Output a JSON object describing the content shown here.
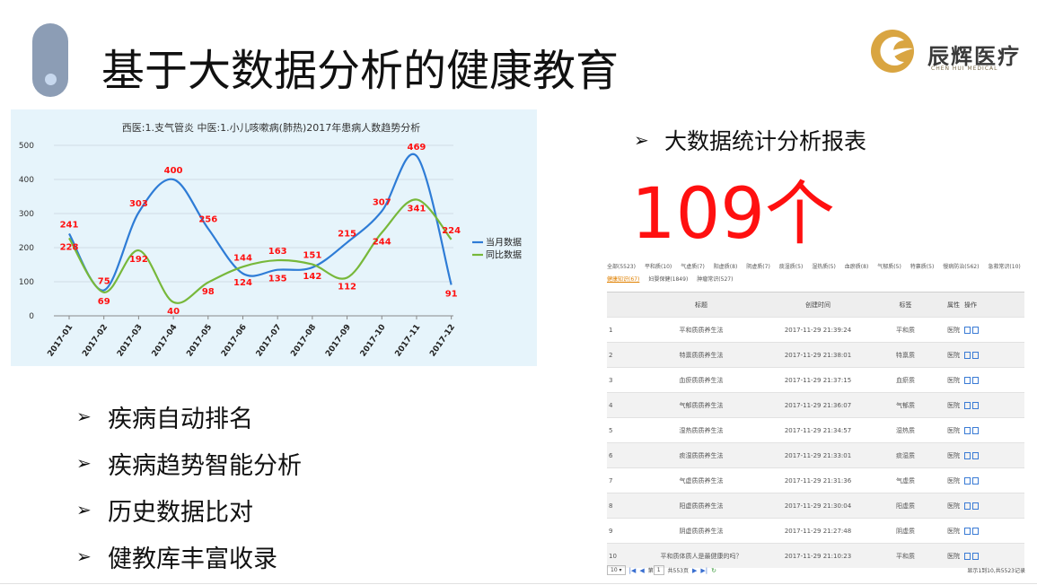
{
  "slide": {
    "title": "基于大数据分析的健康教育",
    "logo_text": "辰辉医疗",
    "logo_sub": "CHEN HUI MEDICAL",
    "bullets": [
      "疾病自动排名",
      "疾病趋势智能分析",
      "历史数据比对",
      "健教库丰富收录"
    ],
    "right_heading": "大数据统计分析报表",
    "big_count": "109个",
    "arrow": "➢"
  },
  "colors": {
    "series_current": "#2e7cd6",
    "series_yoy": "#77b83a",
    "label_red": "#ff1010",
    "panel_bg": "#e6f4fb"
  },
  "chart_data": {
    "type": "line",
    "title": "西医:1.支气管炎 中医:1.小儿咳嗽病(肺热)2017年患病人数趋势分析",
    "categories": [
      "2017-01",
      "2017-02",
      "2017-03",
      "2017-04",
      "2017-05",
      "2017-06",
      "2017-07",
      "2017-08",
      "2017-09",
      "2017-10",
      "2017-11",
      "2017-12"
    ],
    "series": [
      {
        "name": "当月数据",
        "values": [
          241,
          75,
          303,
          400,
          256,
          124,
          135,
          142,
          215,
          307,
          469,
          91
        ]
      },
      {
        "name": "同比数据",
        "values": [
          228,
          69,
          192,
          40,
          98,
          144,
          163,
          151,
          112,
          244,
          341,
          224
        ]
      }
    ],
    "ylim": [
      0,
      500
    ],
    "yticks": [
      0,
      100,
      200,
      300,
      400,
      500
    ],
    "grid": true,
    "legend": "right"
  },
  "report": {
    "filters": [
      {
        "label": "全部(5523)",
        "active": false
      },
      {
        "label": "平和质(10)",
        "active": false
      },
      {
        "label": "气虚质(7)",
        "active": false
      },
      {
        "label": "阳虚质(8)",
        "active": false
      },
      {
        "label": "阴虚质(7)",
        "active": false
      },
      {
        "label": "痰湿质(5)",
        "active": false
      },
      {
        "label": "湿热质(5)",
        "active": false
      },
      {
        "label": "血瘀质(8)",
        "active": false
      },
      {
        "label": "气郁质(5)",
        "active": false
      },
      {
        "label": "特禀质(5)",
        "active": false
      },
      {
        "label": "慢病防治(562)",
        "active": false
      },
      {
        "label": "急救常识(10)",
        "active": false
      },
      {
        "label": "健康知识(67)",
        "active": true
      },
      {
        "label": "妇婴保健(1849)",
        "active": false
      },
      {
        "label": "肿瘤常识(527)",
        "active": false
      }
    ],
    "columns": [
      "",
      "标题",
      "创建时间",
      "标签",
      "属性",
      "操作"
    ],
    "rows": [
      {
        "idx": "1",
        "title": "平和质质养生法",
        "time": "2017-11-29 21:39:24",
        "tag": "平和质",
        "attr": "医院"
      },
      {
        "idx": "2",
        "title": "特禀质质养生法",
        "time": "2017-11-29 21:38:01",
        "tag": "特禀质",
        "attr": "医院"
      },
      {
        "idx": "3",
        "title": "血瘀质质养生法",
        "time": "2017-11-29 21:37:15",
        "tag": "血瘀质",
        "attr": "医院"
      },
      {
        "idx": "4",
        "title": "气郁质质养生法",
        "time": "2017-11-29 21:36:07",
        "tag": "气郁质",
        "attr": "医院"
      },
      {
        "idx": "5",
        "title": "湿热质质养生法",
        "time": "2017-11-29 21:34:57",
        "tag": "湿热质",
        "attr": "医院"
      },
      {
        "idx": "6",
        "title": "痰湿质质养生法",
        "time": "2017-11-29 21:33:01",
        "tag": "痰湿质",
        "attr": "医院"
      },
      {
        "idx": "7",
        "title": "气虚质质养生法",
        "time": "2017-11-29 21:31:36",
        "tag": "气虚质",
        "attr": "医院"
      },
      {
        "idx": "8",
        "title": "阳虚质质养生法",
        "time": "2017-11-29 21:30:04",
        "tag": "阳虚质",
        "attr": "医院"
      },
      {
        "idx": "9",
        "title": "阴虚质质养生法",
        "time": "2017-11-29 21:27:48",
        "tag": "阴虚质",
        "attr": "医院"
      },
      {
        "idx": "10",
        "title": "平和质体质人是最健康的吗？",
        "time": "2017-11-29 21:10:23",
        "tag": "平和质",
        "attr": "医院"
      }
    ],
    "pager": {
      "page_size": "10",
      "page_label": "第",
      "page": "1",
      "total_pages": "共553页",
      "summary": "显示1到10,共5523记录"
    }
  }
}
